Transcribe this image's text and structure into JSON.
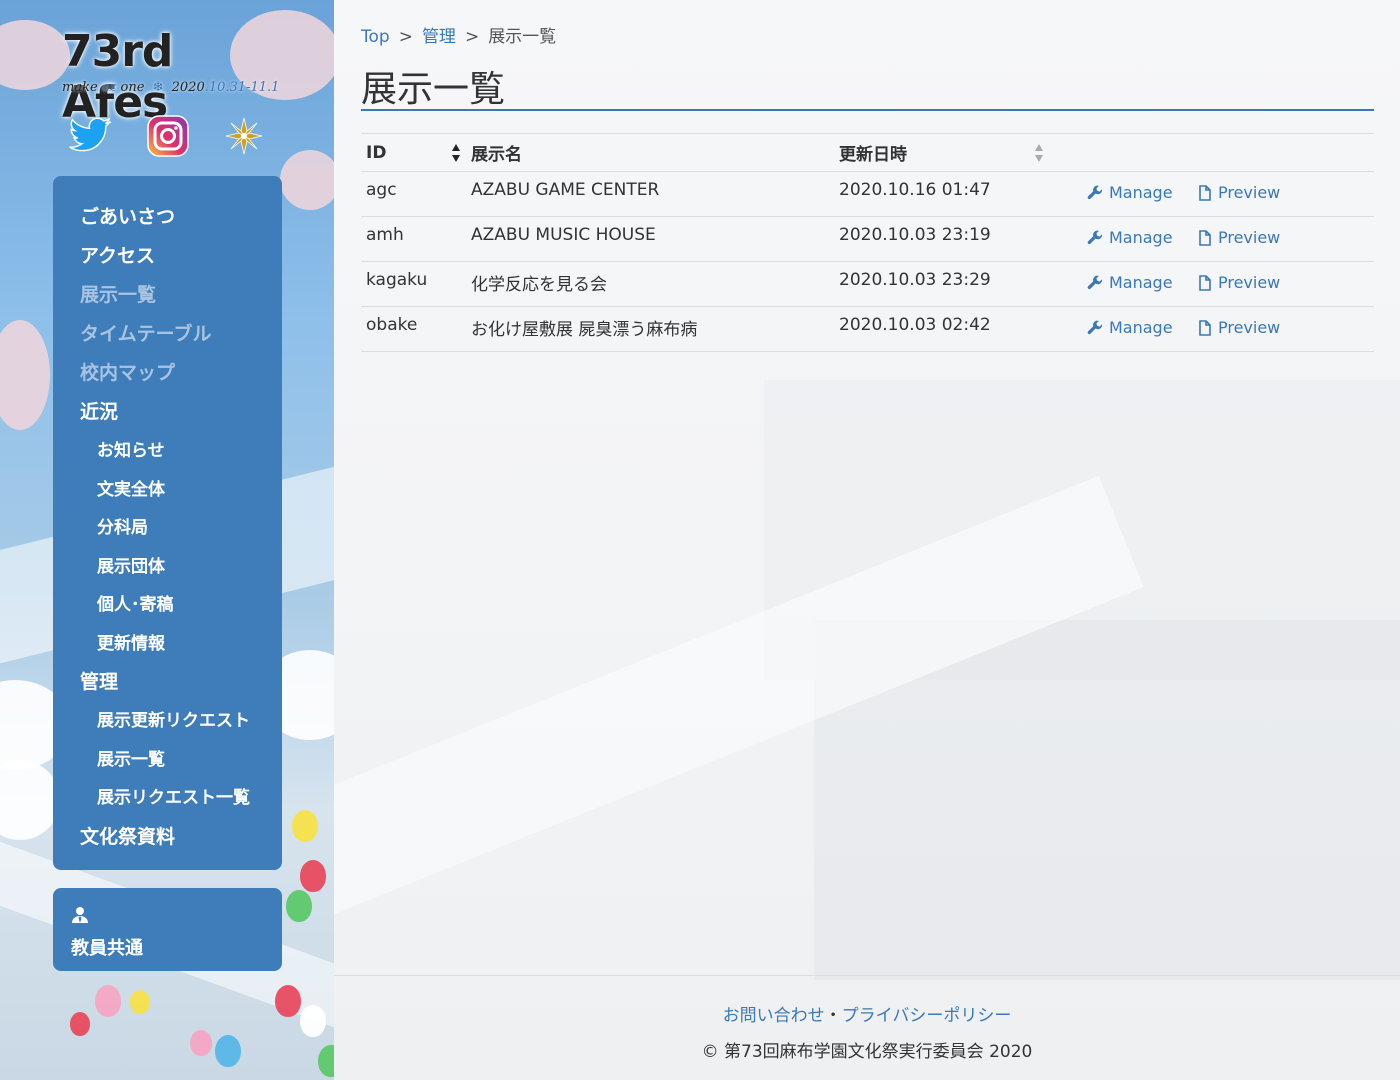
{
  "brand": {
    "title": "73rd Afes",
    "tagline_make": "make",
    "tagline_az": "az",
    "tagline_one": "one",
    "tagline_date": "2020",
    "tagline_date_range": ".10.31-11.1",
    "accent": "#3e7db9"
  },
  "social": {
    "twitter_icon": "twitter-icon",
    "instagram_icon": "instagram-icon",
    "emblem_icon": "school-emblem-icon"
  },
  "menu": {
    "items": [
      {
        "label": "ごあいさつ"
      },
      {
        "label": "アクセス"
      },
      {
        "label": "展示一覧"
      },
      {
        "label": "タイムテーブル"
      },
      {
        "label": "校内マップ"
      },
      {
        "label": "近況"
      },
      {
        "label": "お知らせ"
      },
      {
        "label": "文実全体"
      },
      {
        "label": "分科局"
      },
      {
        "label": "展示団体"
      },
      {
        "label": "個人･寄稿"
      },
      {
        "label": "更新情報"
      },
      {
        "label": "管理"
      },
      {
        "label": "展示更新リクエスト"
      },
      {
        "label": "展示一覧"
      },
      {
        "label": "展示リクエスト一覧"
      },
      {
        "label": "文化祭資料"
      }
    ],
    "teacher_label": "教員共通"
  },
  "breadcrumb": {
    "top": "Top",
    "sep1": ">",
    "admin": "管理",
    "sep2": ">",
    "current": "展示一覧"
  },
  "page_title": "展示一覧",
  "table": {
    "headers": {
      "id": "ID",
      "name": "展示名",
      "updated": "更新日時"
    },
    "rows": [
      {
        "id": "agc",
        "name": "AZABU GAME CENTER",
        "updated": "2020.10.16 01:47",
        "manage": "Manage",
        "preview": "Preview"
      },
      {
        "id": "amh",
        "name": "AZABU MUSIC HOUSE",
        "updated": "2020.10.03 23:19",
        "manage": "Manage",
        "preview": "Preview"
      },
      {
        "id": "kagaku",
        "name": "化学反応を見る会",
        "updated": "2020.10.03 23:29",
        "manage": "Manage",
        "preview": "Preview"
      },
      {
        "id": "obake",
        "name": "お化け屋敷展 屍臭漂う麻布病",
        "updated": "2020.10.03 02:42",
        "manage": "Manage",
        "preview": "Preview"
      }
    ]
  },
  "footer": {
    "contact": "お問い合わせ",
    "dot": "・",
    "privacy": "プライバシーポリシー",
    "copyright": "© 第73回麻布学園文化祭実行委員会 2020"
  }
}
